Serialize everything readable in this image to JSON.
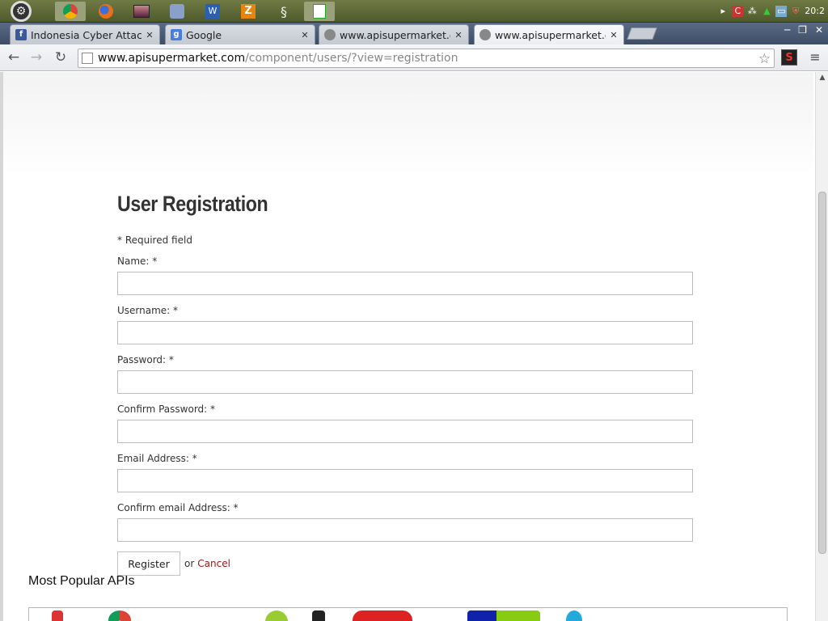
{
  "os": {
    "clock": "20:2",
    "launchers": [
      "chrome-icon",
      "firefox-icon",
      "photo-viewer-icon",
      "settings-icon",
      "word-icon",
      "filezilla-icon",
      "spiral-icon",
      "chart-editor-icon"
    ]
  },
  "tabs": [
    {
      "title": "Indonesia Cyber Attac",
      "favicon": "facebook-icon",
      "active": false
    },
    {
      "title": "Google",
      "favicon": "google-icon",
      "active": false
    },
    {
      "title": "www.apisupermarket.c",
      "favicon": "globe-icon",
      "active": false
    },
    {
      "title": "www.apisupermarket.c",
      "favicon": "globe-icon",
      "active": true
    }
  ],
  "toolbar": {
    "url_host": "www.apisupermarket.com",
    "url_path": "/component/users/?view=registration"
  },
  "form": {
    "title": "User Registration",
    "required_note": "* Required field",
    "fields": [
      {
        "label": "Name: *",
        "value": ""
      },
      {
        "label": "Username: *",
        "value": ""
      },
      {
        "label": "Password: *",
        "value": ""
      },
      {
        "label": "Confirm Password: *",
        "value": ""
      },
      {
        "label": "Email Address: *",
        "value": ""
      },
      {
        "label": "Confirm email Address: *",
        "value": ""
      }
    ],
    "register_label": "Register",
    "or_text": "or",
    "cancel_label": "Cancel"
  },
  "popular": {
    "title": "Most Popular APIs"
  },
  "colors": {
    "cancel_link": "#a01818",
    "heading": "#333333"
  }
}
